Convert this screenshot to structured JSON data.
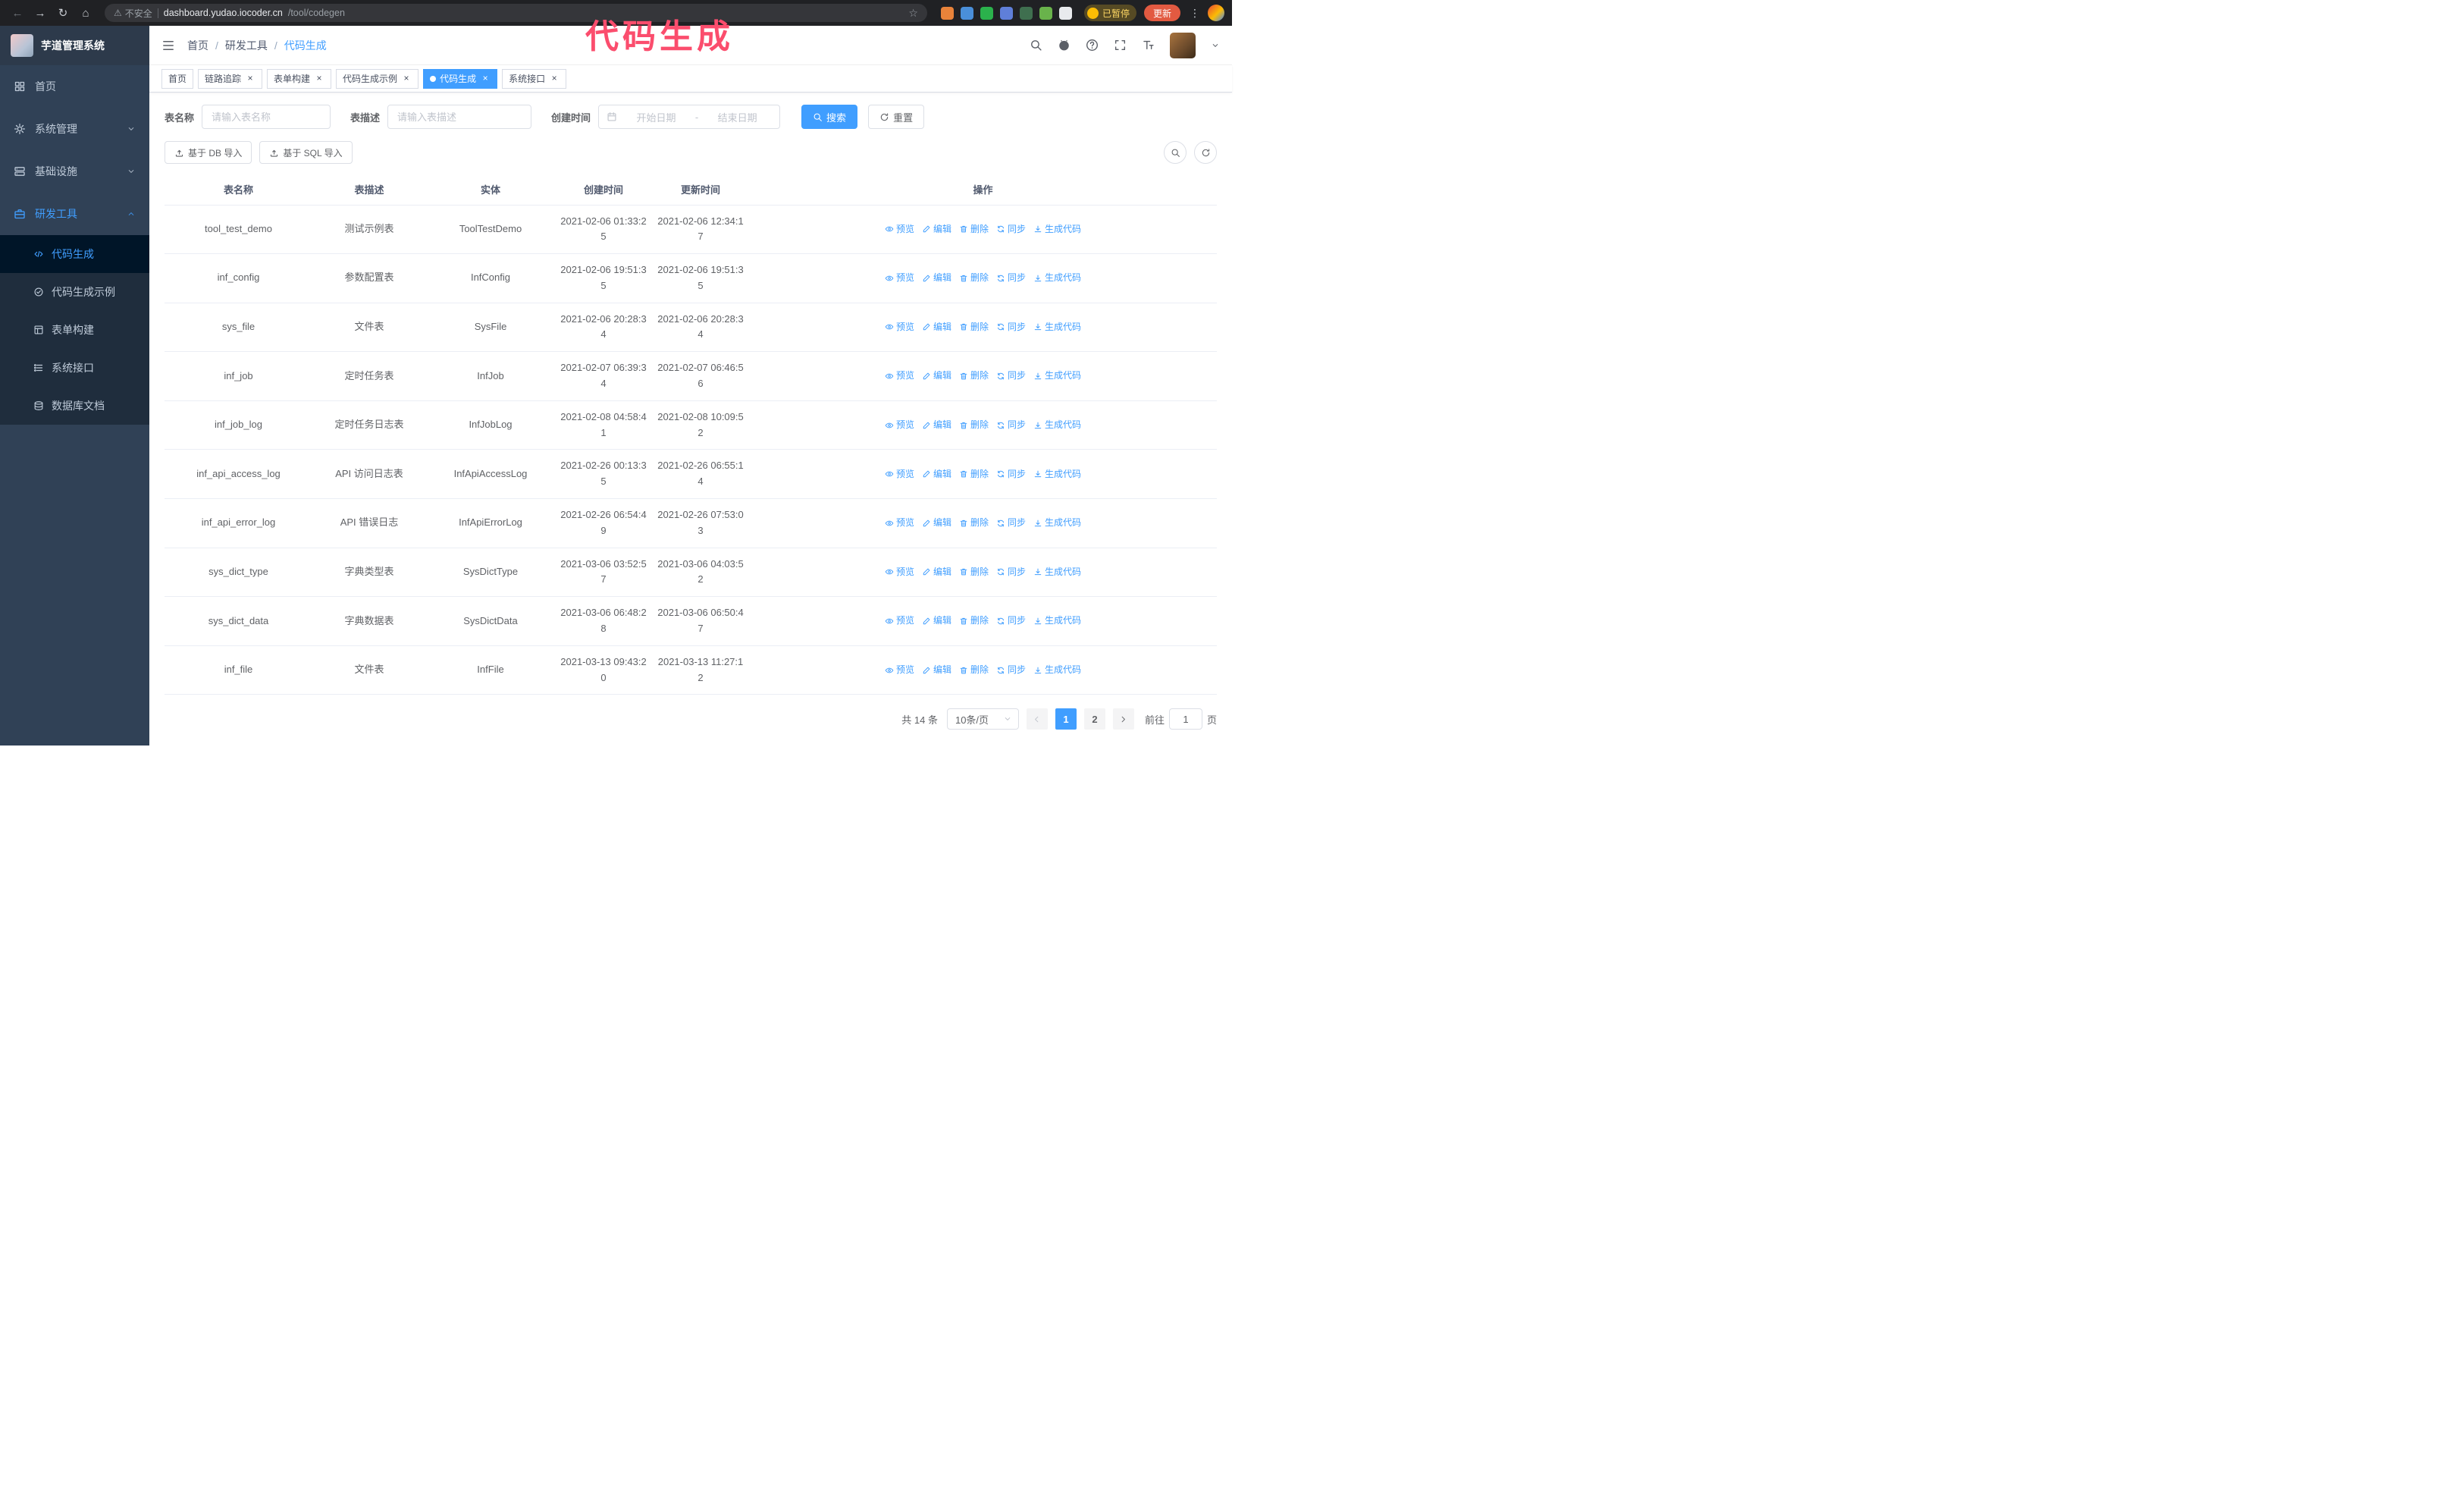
{
  "annotation": {
    "text": "代码生成",
    "color": "#fb4d6d"
  },
  "colors": {
    "accent": "#409eff",
    "update_button": "#e25a41"
  },
  "icons": {
    "back": "←",
    "forward": "→",
    "reload": "↻",
    "home": "⌂",
    "warning": "⚠",
    "star": "☆",
    "kebab": "⋮",
    "close": "×"
  },
  "browser": {
    "security_label": "不安全",
    "url_host": "dashboard.yudao.iocoder.cn",
    "url_path": "/tool/codegen",
    "paused_badge": "已暂停",
    "update_button": "更新",
    "extensions": [
      {
        "name": "extension-icon-1",
        "color": "#e8833a"
      },
      {
        "name": "extension-icon-2",
        "color": "#4a8fd9"
      },
      {
        "name": "extension-icon-3",
        "color": "#2bb24c"
      },
      {
        "name": "extension-icon-4",
        "color": "#5f7fd9"
      },
      {
        "name": "extension-icon-5",
        "color": "#3f6f4f"
      },
      {
        "name": "extension-icon-6",
        "color": "#69b34b"
      },
      {
        "name": "extension-icon-7",
        "color": "#e8eaed"
      }
    ]
  },
  "sidebar": {
    "logo_title": "芋道管理系统",
    "items": [
      {
        "label": "首页",
        "icon": "home-icon"
      },
      {
        "label": "系统管理",
        "icon": "gear-icon",
        "chevron": "down"
      },
      {
        "label": "基础设施",
        "icon": "infra-icon",
        "chevron": "down"
      },
      {
        "label": "研发工具",
        "icon": "tools-icon",
        "chevron": "up",
        "active": true,
        "expanded": true
      }
    ],
    "subitems": [
      {
        "label": "代码生成",
        "icon": "code-icon",
        "active": true
      },
      {
        "label": "代码生成示例",
        "icon": "example-icon"
      },
      {
        "label": "表单构建",
        "icon": "form-icon"
      },
      {
        "label": "系统接口",
        "icon": "api-icon"
      },
      {
        "label": "数据库文档",
        "icon": "db-icon"
      }
    ]
  },
  "header": {
    "breadcrumb": [
      "首页",
      "研发工具",
      "代码生成"
    ],
    "separator": "/"
  },
  "tabs": [
    {
      "label": "首页",
      "closable": false,
      "active": false
    },
    {
      "label": "链路追踪",
      "closable": true,
      "active": false
    },
    {
      "label": "表单构建",
      "closable": true,
      "active": false
    },
    {
      "label": "代码生成示例",
      "closable": true,
      "active": false
    },
    {
      "label": "代码生成",
      "closable": true,
      "active": true
    },
    {
      "label": "系统接口",
      "closable": true,
      "active": false
    }
  ],
  "filters": {
    "table_name_label": "表名称",
    "table_name_placeholder": "请输入表名称",
    "table_desc_label": "表描述",
    "table_desc_placeholder": "请输入表描述",
    "create_time_label": "创建时间",
    "date_start_placeholder": "开始日期",
    "date_separator": "-",
    "date_end_placeholder": "结束日期",
    "search_button": "搜索",
    "reset_button": "重置"
  },
  "toolbar": {
    "import_db": "基于 DB 导入",
    "import_sql": "基于 SQL 导入"
  },
  "table": {
    "columns": [
      "表名称",
      "表描述",
      "实体",
      "创建时间",
      "更新时间",
      "操作"
    ],
    "actions": [
      {
        "label": "预览",
        "icon": "eye-icon"
      },
      {
        "label": "编辑",
        "icon": "edit-icon"
      },
      {
        "label": "删除",
        "icon": "delete-icon"
      },
      {
        "label": "同步",
        "icon": "sync-icon"
      },
      {
        "label": "生成代码",
        "icon": "gencode-icon"
      }
    ],
    "rows": [
      {
        "name": "tool_test_demo",
        "desc": "测试示例表",
        "entity": "ToolTestDemo",
        "created": "2021-02-06 01:33:25",
        "updated": "2021-02-06 12:34:17"
      },
      {
        "name": "inf_config",
        "desc": "参数配置表",
        "entity": "InfConfig",
        "created": "2021-02-06 19:51:35",
        "updated": "2021-02-06 19:51:35"
      },
      {
        "name": "sys_file",
        "desc": "文件表",
        "entity": "SysFile",
        "created": "2021-02-06 20:28:34",
        "updated": "2021-02-06 20:28:34"
      },
      {
        "name": "inf_job",
        "desc": "定时任务表",
        "entity": "InfJob",
        "created": "2021-02-07 06:39:34",
        "updated": "2021-02-07 06:46:56"
      },
      {
        "name": "inf_job_log",
        "desc": "定时任务日志表",
        "entity": "InfJobLog",
        "created": "2021-02-08 04:58:41",
        "updated": "2021-02-08 10:09:52"
      },
      {
        "name": "inf_api_access_log",
        "desc": "API 访问日志表",
        "entity": "InfApiAccessLog",
        "created": "2021-02-26 00:13:35",
        "updated": "2021-02-26 06:55:14"
      },
      {
        "name": "inf_api_error_log",
        "desc": "API 错误日志",
        "entity": "InfApiErrorLog",
        "created": "2021-02-26 06:54:49",
        "updated": "2021-02-26 07:53:03"
      },
      {
        "name": "sys_dict_type",
        "desc": "字典类型表",
        "entity": "SysDictType",
        "created": "2021-03-06 03:52:57",
        "updated": "2021-03-06 04:03:52"
      },
      {
        "name": "sys_dict_data",
        "desc": "字典数据表",
        "entity": "SysDictData",
        "created": "2021-03-06 06:48:28",
        "updated": "2021-03-06 06:50:47"
      },
      {
        "name": "inf_file",
        "desc": "文件表",
        "entity": "InfFile",
        "created": "2021-03-13 09:43:20",
        "updated": "2021-03-13 11:27:12"
      }
    ]
  },
  "pagination": {
    "total": "共 14 条",
    "page_size": "10条/页",
    "pages": [
      {
        "label": "1",
        "active": true
      },
      {
        "label": "2",
        "active": false
      }
    ],
    "goto_label": "前往",
    "goto_value": "1",
    "goto_unit": "页"
  }
}
